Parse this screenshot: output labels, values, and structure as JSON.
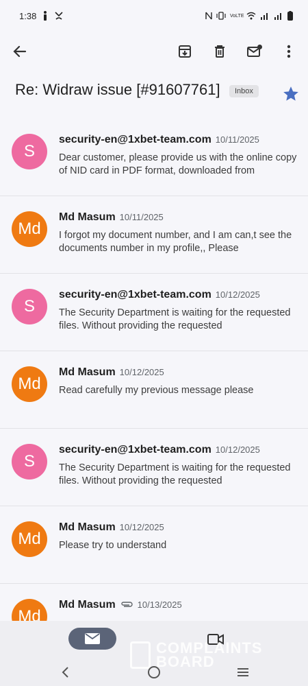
{
  "status": {
    "time": "1:38",
    "network_text": "VoLTE"
  },
  "subject": {
    "title": "Re: Widraw issue [#91607761]",
    "label": "Inbox"
  },
  "colors": {
    "avatar_pink": "#ee6aa0",
    "avatar_orange": "#ef7a12",
    "star": "#4a6fc1"
  },
  "messages": [
    {
      "initial": "S",
      "color": "pink",
      "sender": "security-en@1xbet-team.com",
      "date": "10/11/2025",
      "snippet": "Dear customer, please provide us with the online copy of NID card in PDF format, downloaded from",
      "attachment": false
    },
    {
      "initial": "Md",
      "color": "orange",
      "sender": "Md Masum",
      "date": "10/11/2025",
      "snippet": "I forgot my document number, and I am can,t see the documents number in my profile,, Please",
      "attachment": false
    },
    {
      "initial": "S",
      "color": "pink",
      "sender": "security-en@1xbet-team.com",
      "date": "10/12/2025",
      "snippet": "The Security Department is waiting for the requested files. Without providing the requested",
      "attachment": false
    },
    {
      "initial": "Md",
      "color": "orange",
      "sender": "Md Masum",
      "date": "10/12/2025",
      "snippet": "Read carefully my previous message please",
      "attachment": false
    },
    {
      "initial": "S",
      "color": "pink",
      "sender": "security-en@1xbet-team.com",
      "date": "10/12/2025",
      "snippet": "The Security Department is waiting for the requested files. Without providing the requested",
      "attachment": false
    },
    {
      "initial": "Md",
      "color": "orange",
      "sender": "Md Masum",
      "date": "10/12/2025",
      "snippet": "Please try to understand",
      "attachment": false
    },
    {
      "initial": "Md",
      "color": "orange",
      "sender": "Md Masum",
      "date": "10/13/2025",
      "snippet": "",
      "attachment": true
    }
  ],
  "icons": {
    "toolbar": [
      "back-arrow-icon",
      "archive-icon",
      "delete-icon",
      "mark-unread-icon",
      "more-vert-icon"
    ],
    "bottom_nav": [
      "mail-icon",
      "meet-video-icon"
    ]
  },
  "watermark": {
    "line1": "COMPLAINTS",
    "line2": "BOARD"
  }
}
